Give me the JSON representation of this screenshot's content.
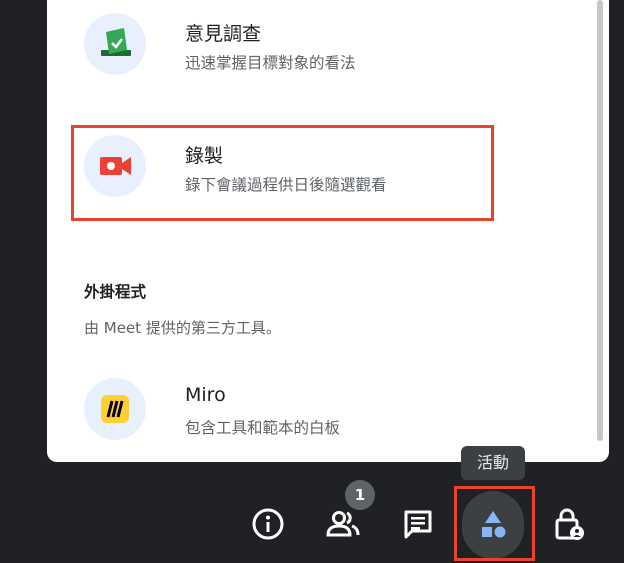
{
  "panel": {
    "items": [
      {
        "title": "意見調查",
        "desc": "迅速掌握目標對象的看法",
        "icon": "poll-ballot-icon"
      },
      {
        "title": "錄製",
        "desc": "錄下會議過程供日後隨選觀看",
        "icon": "video-record-icon"
      }
    ],
    "addons": {
      "heading": "外掛程式",
      "subtitle": "由 Meet 提供的第三方工具。",
      "items": [
        {
          "title": "Miro",
          "desc": "包含工具和範本的白板",
          "icon": "miro-logo-icon"
        }
      ]
    }
  },
  "tooltip": {
    "label": "活動"
  },
  "toolbar": {
    "people_count": "1",
    "buttons": [
      "info-icon",
      "people-icon",
      "chat-icon",
      "activities-icon",
      "host-controls-icon"
    ]
  },
  "colors": {
    "highlight": "#e8432b",
    "accent": "#8ab4f8",
    "record_red": "#ea4335",
    "poll_green": "#34a853"
  }
}
